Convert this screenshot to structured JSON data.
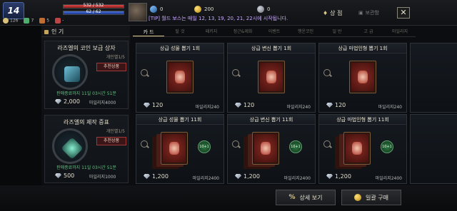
{
  "topbar": {
    "level": "14",
    "hp_text": "532 / 532",
    "hp_fraction": 1.0,
    "mp_text": "62 / 62",
    "mp_fraction": 1.0,
    "stats": [
      "126",
      "7",
      "5",
      "-"
    ],
    "currency_a": "0",
    "currency_b": "200",
    "currency_c": "0",
    "notice": "[TIP] 월드 보스는 매일 12, 13, 19, 20, 21, 22시에 시작됩니다.",
    "store_label": "상 점",
    "storage_label": "보관함",
    "close_label": "✕"
  },
  "popular": {
    "header": "인 기",
    "items": [
      {
        "title": "라즈엘의 코인 보급 상자",
        "limit": "개인별1/5",
        "tag": "추천상품",
        "sale": "판매종료까지 11일 03시간 51분",
        "price": "2,000",
        "mileage": "마일리지4000"
      },
      {
        "title": "라즈엘의 제작 증표",
        "limit": "개인별1/5",
        "tag": "추천상품",
        "sale": "판매종료까지 11일 03시간 51분",
        "price": "500",
        "mileage": "마일리지1000"
      }
    ]
  },
  "tabs": [
    "카 드",
    "탈 것",
    "패키지",
    "정근&제화",
    "이벤트",
    "행운코인",
    "일 반",
    "고 급",
    "마일리지"
  ],
  "cards": [
    {
      "title": "상급 성물 뽑기 1회",
      "price": "120",
      "mileage": "마일리지240",
      "bonus": ""
    },
    {
      "title": "상급 변신 뽑기 1회",
      "price": "120",
      "mileage": "마일리지240",
      "bonus": ""
    },
    {
      "title": "상급 마법인형 뽑기 1회",
      "price": "120",
      "mileage": "마일리지240",
      "bonus": ""
    },
    {
      "title": "상급 성물 뽑기 11회",
      "price": "1,200",
      "mileage": "마일리지2400",
      "bonus": "10+1"
    },
    {
      "title": "상급 변신 뽑기 11회",
      "price": "1,200",
      "mileage": "마일리지2400",
      "bonus": "10+1"
    },
    {
      "title": "상급 마법인형 뽑기 11회",
      "price": "1,200",
      "mileage": "마일리지2400",
      "bonus": "10+1"
    }
  ],
  "bottom": {
    "detail_label": "상세 보기",
    "bulk_label": "일괄 구매"
  }
}
